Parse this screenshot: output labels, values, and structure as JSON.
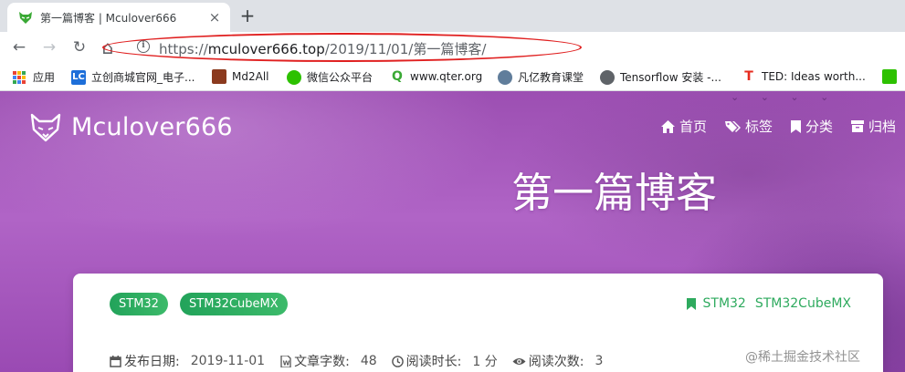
{
  "browser": {
    "tab": {
      "title": "第一篇博客 | Mculover666",
      "close_icon": "close-icon"
    },
    "new_tab_label": "+",
    "nav": {
      "back": "←",
      "forward": "→",
      "reload": "↻",
      "home": "⌂"
    },
    "url": {
      "scheme": "https://",
      "host": "mculover666.top",
      "path": "/2019/11/01/第一篇博客/"
    },
    "bookmarks": [
      {
        "label": "应用",
        "icon": "apps-grid-icon"
      },
      {
        "label": "立创商城官网_电子...",
        "icon": "lc-icon",
        "icon_text": "LC",
        "color": "#1e6fd9"
      },
      {
        "label": "Md2All",
        "icon": "md2all-icon",
        "color": "#8b3a1e"
      },
      {
        "label": "微信公众平台",
        "icon": "wechat-icon",
        "color": "#2dc100"
      },
      {
        "label": "www.qter.org",
        "icon": "qter-icon",
        "icon_text": "Q",
        "color": "#3aa935"
      },
      {
        "label": "凡亿教育课堂",
        "icon": "person-icon",
        "color": "#607d9b"
      },
      {
        "label": "Tensorflow 安装 -...",
        "icon": "globe-icon",
        "color": "#5f6368"
      },
      {
        "label": "TED: Ideas worth...",
        "icon": "ted-icon",
        "icon_text": "T",
        "color": "#e62b1e"
      }
    ],
    "annotation_color": "#e02020"
  },
  "site": {
    "name": "Mculover666",
    "menu": [
      {
        "label": "首页",
        "icon": "home-icon"
      },
      {
        "label": "标签",
        "icon": "tags-icon"
      },
      {
        "label": "分类",
        "icon": "bookmark-icon"
      },
      {
        "label": "归档",
        "icon": "archive-icon"
      }
    ],
    "birds": "⌄ ⌄ ⌄ ⌄"
  },
  "post": {
    "title": "第一篇博客",
    "tags": [
      "STM32",
      "STM32CubeMX"
    ],
    "categories": [
      "STM32",
      "STM32CubeMX"
    ],
    "meta": [
      {
        "label": "发布日期:",
        "value": "2019-11-01",
        "icon": "calendar-icon"
      },
      {
        "label": "文章字数:",
        "value": "48",
        "icon": "word-doc-icon"
      },
      {
        "label": "阅读时长:",
        "value": "1 分",
        "icon": "clock-icon"
      },
      {
        "label": "阅读次数:",
        "value": "3",
        "icon": "eye-icon"
      }
    ]
  },
  "watermark": "@稀土掘金技术社区",
  "colors": {
    "tag_green": "#2aa85e",
    "hero_purple": "#a85bc0"
  }
}
